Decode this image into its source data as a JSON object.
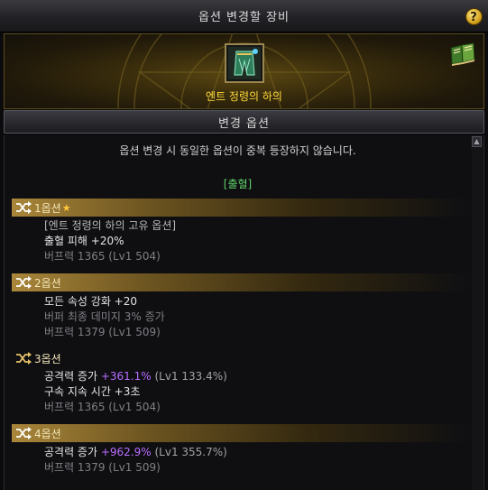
{
  "window": {
    "title": "옵션 변경할 장비",
    "help_label": "?"
  },
  "item": {
    "name": "엔트 정령의 하의"
  },
  "section": {
    "title": "변경 옵션"
  },
  "notice": "옵션 변경 시 동일한 옵션이 중복 등장하지 않습니다.",
  "category": "[출혈]",
  "options": [
    {
      "label": "1옵션",
      "star": "★",
      "unique_note": "[엔트 정령의 하의 고유 옵션]",
      "effect": "출혈 피해 +20%",
      "buff": "버프력 1365 (Lv1 504)"
    },
    {
      "label": "2옵션",
      "effect": "모든 속성 강화 +20",
      "sub": "버퍼 최종 데미지 3% 증가",
      "buff": "버프력 1379 (Lv1 509)"
    },
    {
      "label": "3옵션",
      "effect1_name": "공격력 증가",
      "effect1_value": "+361.1%",
      "effect1_lv": "(Lv1 133.4%)",
      "effect2": "구속 지속 시간 +3초",
      "buff": "버프력 1365 (Lv1 504)"
    },
    {
      "label": "4옵션",
      "effect1_name": "공격력 증가",
      "effect1_value": "+962.9%",
      "effect1_lv": "(Lv1 355.7%)",
      "buff": "버프력 1379 (Lv1 509)"
    }
  ],
  "colors": {
    "gold_text": "#ffd93b",
    "category_green": "#5fd06a",
    "value_purple": "#b86cff"
  }
}
